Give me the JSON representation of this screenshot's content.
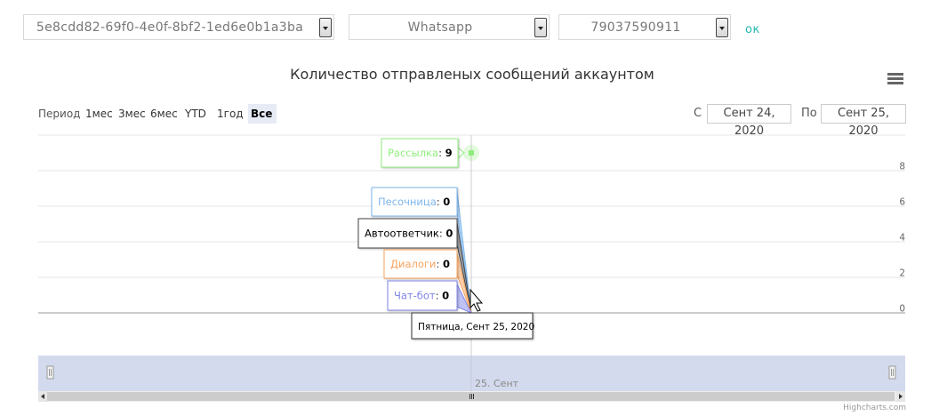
{
  "selectors": {
    "account": "5e8cdd82-69f0-4e0f-8bf2-1ed6e0b1a3ba",
    "messenger": "Whatsapp",
    "phone": "79037590911",
    "ok_label": "ок"
  },
  "range_selector": {
    "label": "Период",
    "buttons": [
      "1мес",
      "3мес",
      "6мес",
      "YTD",
      "1год",
      "Все"
    ],
    "active": "Все",
    "from_label": "С",
    "from_value": "Сент 24, 2020",
    "to_label": "По",
    "to_value": "Сент 25, 2020"
  },
  "credits": "Highcharts.com",
  "chart_data": {
    "type": "line",
    "title": "Количество отправленых сообщений аккаунтом",
    "y_ticks": [
      "0",
      "2",
      "4",
      "6",
      "8"
    ],
    "ylim": [
      0,
      9
    ],
    "grid": true,
    "x": [
      "2020-09-25"
    ],
    "series": [
      {
        "name": "Рассылка",
        "values": [
          9
        ],
        "color": "#90ed7d"
      },
      {
        "name": "Песочница",
        "values": [
          0
        ],
        "color": "#7cb5ec"
      },
      {
        "name": "Автоответчик",
        "values": [
          0
        ],
        "color": "#434348"
      },
      {
        "name": "Диалоги",
        "values": [
          0
        ],
        "color": "#f7a35c"
      },
      {
        "name": "Чат-бот",
        "values": [
          0
        ],
        "color": "#8085e9"
      }
    ],
    "tooltip_header": "Пятница, Сент 25, 2020",
    "navigator_label": "25. Сент"
  }
}
